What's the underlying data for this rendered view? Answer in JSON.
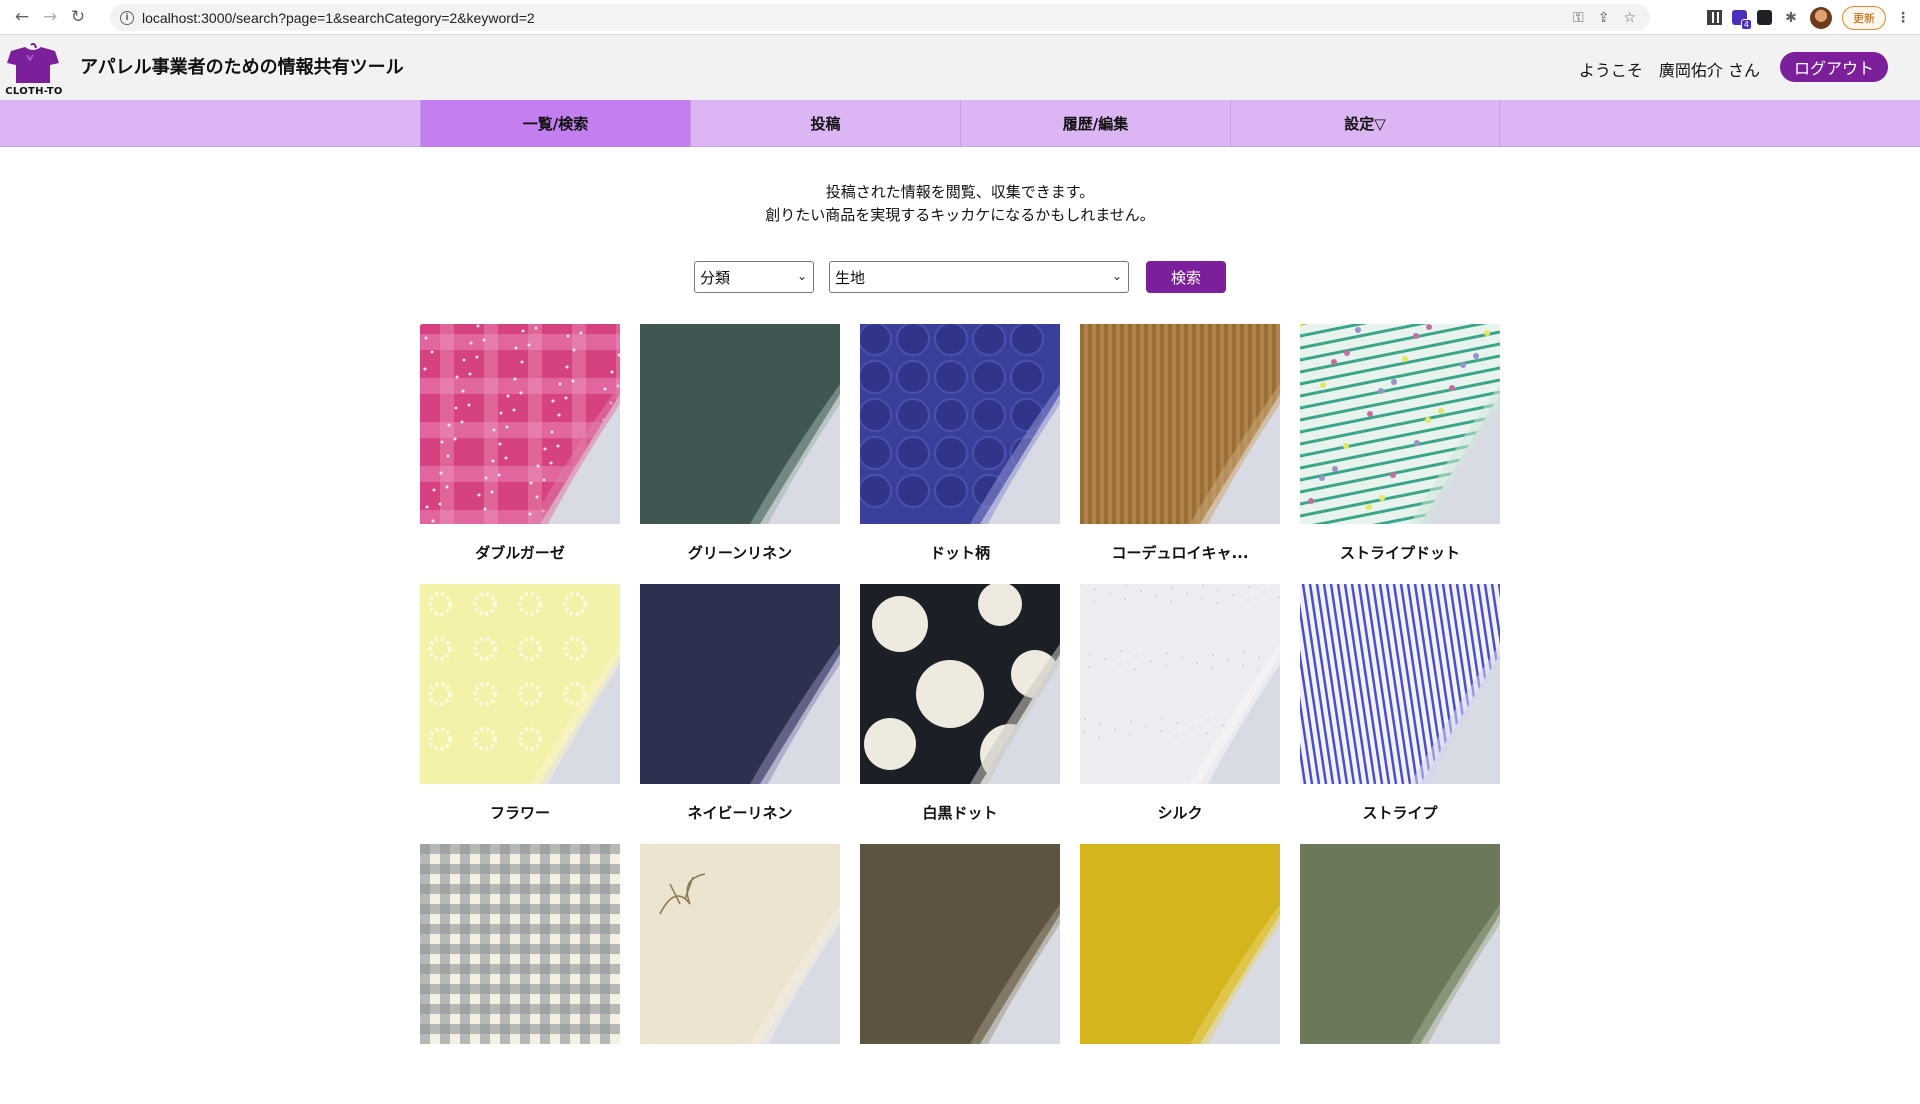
{
  "browser": {
    "url": "localhost:3000/search?page=1&searchCategory=2&keyword=2",
    "update_label": "更新",
    "extension_badge": "4"
  },
  "header": {
    "logo_text": "CLOTH-TO",
    "title": "アパレル事業者のための情報共有ツール",
    "welcome": "ようこそ",
    "username": "廣岡佑介 さん",
    "logout_label": "ログアウト"
  },
  "nav": {
    "tabs": [
      {
        "label": "一覧/検索",
        "active": true
      },
      {
        "label": "投稿",
        "active": false
      },
      {
        "label": "履歴/編集",
        "active": false
      },
      {
        "label": "設定▽",
        "active": false
      }
    ]
  },
  "intro": {
    "line1": "投稿された情報を閲覧、収集できます。",
    "line2": "創りたい商品を実現するキッカケになるかもしれません。"
  },
  "search": {
    "category_selected": "分類",
    "keyword_selected": "生地",
    "button_label": "検索"
  },
  "items": [
    {
      "label": "ダブルガーゼ",
      "pattern": "pink-sparkle"
    },
    {
      "label": "グリーンリネン",
      "pattern": "solid-green"
    },
    {
      "label": "ドット柄",
      "pattern": "navy-dots"
    },
    {
      "label": "コーデュロイキャ...",
      "pattern": "corduroy"
    },
    {
      "label": "ストライプドット",
      "pattern": "stripe-dot"
    },
    {
      "label": "フラワー",
      "pattern": "yellow-flower"
    },
    {
      "label": "ネイビーリネン",
      "pattern": "solid-navy"
    },
    {
      "label": "白黒ドット",
      "pattern": "black-white-dots"
    },
    {
      "label": "シルク",
      "pattern": "white-silk"
    },
    {
      "label": "ストライプ",
      "pattern": "blue-stripe"
    },
    {
      "label": "",
      "pattern": "gingham"
    },
    {
      "label": "",
      "pattern": "embroidery"
    },
    {
      "label": "",
      "pattern": "solid-brown"
    },
    {
      "label": "",
      "pattern": "solid-mustard"
    },
    {
      "label": "",
      "pattern": "solid-olive"
    }
  ],
  "colors": {
    "accent": "#7b1f9a",
    "nav_bg": "#dcb6f4",
    "nav_active": "#c37ef0"
  }
}
